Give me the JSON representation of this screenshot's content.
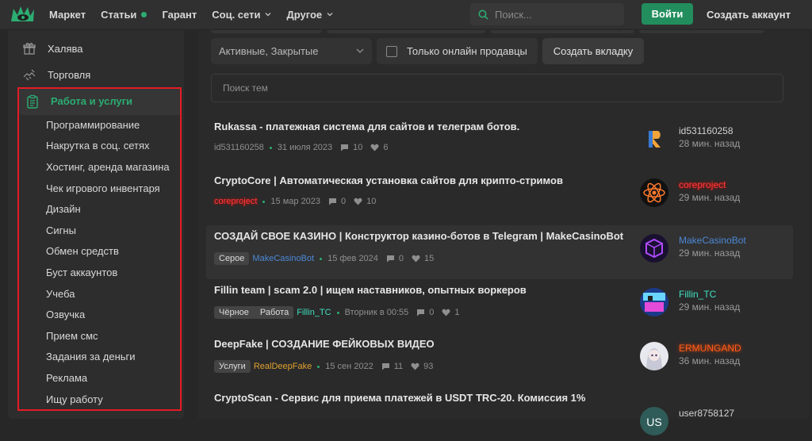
{
  "nav": {
    "items": [
      {
        "label": "Маркет"
      },
      {
        "label": "Статьи"
      },
      {
        "label": "Гарант"
      },
      {
        "label": "Соц. сети"
      },
      {
        "label": "Другое"
      }
    ],
    "search_placeholder": "Поиск...",
    "login": "Войти",
    "signup": "Создать аккаунт"
  },
  "sidebar": {
    "top_items": [
      {
        "label": "Халява"
      },
      {
        "label": "Торговля"
      }
    ],
    "active": "Работа и услуги",
    "sub_items": [
      "Программирование",
      "Накрутка в соц. сетях",
      "Хостинг, аренда магазина",
      "Чек игрового инвентаря",
      "Дизайн",
      "Сигны",
      "Обмен средств",
      "Буст аккаунтов",
      "Учеба",
      "Озвучка",
      "Прием смс",
      "Задания за деньги",
      "Реклама",
      "Ищу работу"
    ]
  },
  "filters": {
    "status_select": "Активные, Закрытые",
    "online_only": "Только онлайн продавцы",
    "create_tab": "Создать вкладку",
    "topic_search_placeholder": "Поиск тем"
  },
  "threads": [
    {
      "title": "Rukassa - платежная система для сайтов и телеграм ботов.",
      "author": "id531160258",
      "date": "31 июля 2023",
      "replies": "10",
      "likes": "6",
      "last_user": "id531160258",
      "last_time": "28 мин. назад",
      "user_color": "#d2d2d2"
    },
    {
      "title": "CryptoCore | Автоматическая установка сайтов для крипто-стримов",
      "author": "coreproject",
      "date": "15 мар 2023",
      "replies": "0",
      "likes": "10",
      "last_user": "coreproject",
      "last_time": "29 мин. назад",
      "user_color": "#ff3b3b"
    },
    {
      "title": "СОЗДАЙ СВОЕ КАЗИНО | Конструктор казино-ботов в Telegram | MakeCasinoBot",
      "tag": "Серое",
      "author": "MakeCasinoBot",
      "date": "15 фев 2024",
      "replies": "0",
      "likes": "15",
      "last_user": "MakeCasinoBot",
      "last_time": "29 мин. назад",
      "user_color": "#4c88d6"
    },
    {
      "title": "Fillin team | scam 2.0 | ищем наставников, опытных воркеров",
      "tags": [
        "Чёрное",
        "Работа"
      ],
      "author": "Fillin_TC",
      "date": "Вторник в 00:55",
      "replies": "0",
      "likes": "1",
      "last_user": "Fillin_TC",
      "last_time": "29 мин. назад",
      "user_color": "#3fe0c0"
    },
    {
      "title": "DeepFake | СОЗДАНИЕ ФЕЙКОВЫХ ВИДЕО",
      "tag": "Услуги",
      "author": "RealDeepFake",
      "date": "15 сен 2022",
      "replies": "11",
      "likes": "93",
      "last_user": "ERMUNGAND",
      "last_time": "36 мин. назад",
      "user_color": "#e0a030"
    },
    {
      "title": "CryptoScan - Сервис для приема платежей в USDT TRC-20. Комиссия 1%",
      "last_user": "user8758127",
      "avatar_text": "US",
      "user_color": "#d2d2d2"
    }
  ]
}
